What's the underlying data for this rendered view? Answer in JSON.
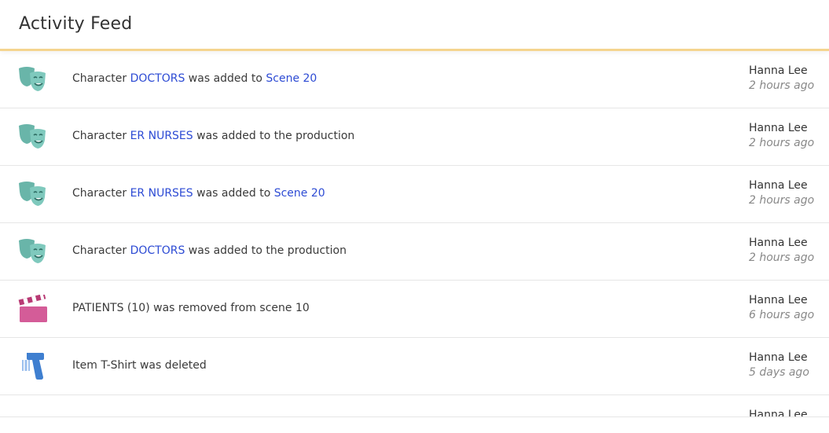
{
  "header": {
    "title": "Activity Feed"
  },
  "feed": [
    {
      "icon": "theater-masks-icon",
      "parts": [
        {
          "text": "Character ",
          "link": false
        },
        {
          "text": "DOCTORS",
          "link": true
        },
        {
          "text": " was added to ",
          "link": false
        },
        {
          "text": "Scene 20",
          "link": true
        }
      ],
      "user": "Hanna Lee",
      "time": "2 hours ago"
    },
    {
      "icon": "theater-masks-icon",
      "parts": [
        {
          "text": "Character ",
          "link": false
        },
        {
          "text": "ER NURSES",
          "link": true
        },
        {
          "text": " was added to the production",
          "link": false
        }
      ],
      "user": "Hanna Lee",
      "time": "2 hours ago"
    },
    {
      "icon": "theater-masks-icon",
      "parts": [
        {
          "text": "Character ",
          "link": false
        },
        {
          "text": "ER NURSES",
          "link": true
        },
        {
          "text": " was added to ",
          "link": false
        },
        {
          "text": "Scene 20",
          "link": true
        }
      ],
      "user": "Hanna Lee",
      "time": "2 hours ago"
    },
    {
      "icon": "theater-masks-icon",
      "parts": [
        {
          "text": "Character ",
          "link": false
        },
        {
          "text": "DOCTORS",
          "link": true
        },
        {
          "text": " was added to the production",
          "link": false
        }
      ],
      "user": "Hanna Lee",
      "time": "2 hours ago"
    },
    {
      "icon": "clapperboard-icon",
      "parts": [
        {
          "text": "PATIENTS (10) was removed from scene 10",
          "link": false
        }
      ],
      "user": "Hanna Lee",
      "time": "6 hours ago"
    },
    {
      "icon": "barcode-scanner-icon",
      "parts": [
        {
          "text": "Item T-Shirt was deleted",
          "link": false
        }
      ],
      "user": "Hanna Lee",
      "time": "5 days ago"
    }
  ],
  "partial_row": {
    "icon": "purple-item-icon",
    "user": "Hanna Lee"
  },
  "colors": {
    "masks": "#4fa89a",
    "clapper": "#d45c98",
    "scanner": "#3f7fd0",
    "link": "#2d4bd4",
    "header_rule": "#f5d58f"
  }
}
